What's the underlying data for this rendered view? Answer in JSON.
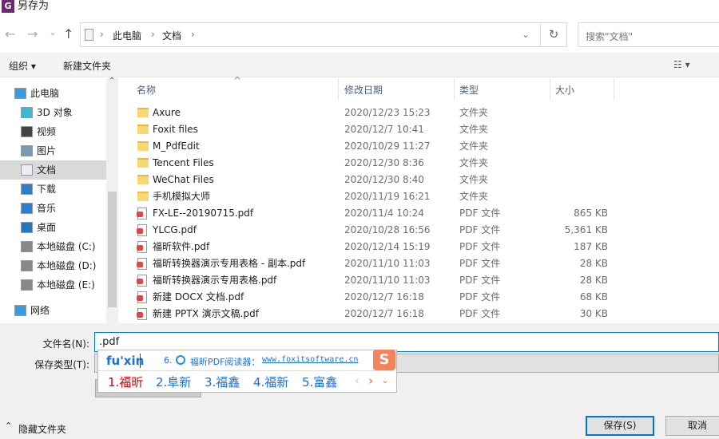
{
  "window": {
    "title": "另存为"
  },
  "nav": {
    "back": "←",
    "forward": "→",
    "recent": "⌄",
    "up": "↑",
    "breadcrumb": [
      "此电脑",
      "文档"
    ],
    "refresh": "↻",
    "search_placeholder": "搜索\"文档\""
  },
  "toolbar": {
    "organize": "组织 ▾",
    "new_folder": "新建文件夹",
    "view": "☷ ▾"
  },
  "sidebar": {
    "items": [
      {
        "label": "此电脑",
        "icon": "computer-icon",
        "indent": 0
      },
      {
        "label": "3D 对象",
        "icon": "cube-icon",
        "indent": 1
      },
      {
        "label": "视频",
        "icon": "video-icon",
        "indent": 1
      },
      {
        "label": "图片",
        "icon": "picture-icon",
        "indent": 1
      },
      {
        "label": "文档",
        "icon": "document-icon",
        "indent": 1,
        "selected": true
      },
      {
        "label": "下载",
        "icon": "download-icon",
        "indent": 1
      },
      {
        "label": "音乐",
        "icon": "music-icon",
        "indent": 1
      },
      {
        "label": "桌面",
        "icon": "desktop-icon",
        "indent": 1
      },
      {
        "label": "本地磁盘 (C:)",
        "icon": "drive-icon",
        "indent": 1
      },
      {
        "label": "本地磁盘 (D:)",
        "icon": "drive-icon",
        "indent": 1
      },
      {
        "label": "本地磁盘 (E:)",
        "icon": "drive-icon",
        "indent": 1
      },
      {
        "label": "网络",
        "icon": "network-icon",
        "indent": 0
      }
    ]
  },
  "columns": {
    "name": "名称",
    "date": "修改日期",
    "type": "类型",
    "size": "大小"
  },
  "files": [
    {
      "name": "Axure",
      "date": "2020/12/23 15:23",
      "type": "文件夹",
      "size": "",
      "kind": "folder"
    },
    {
      "name": "Foxit files",
      "date": "2020/12/7 10:41",
      "type": "文件夹",
      "size": "",
      "kind": "folder"
    },
    {
      "name": "M_PdfEdit",
      "date": "2020/10/29 11:27",
      "type": "文件夹",
      "size": "",
      "kind": "folder"
    },
    {
      "name": "Tencent Files",
      "date": "2020/12/30 8:36",
      "type": "文件夹",
      "size": "",
      "kind": "folder"
    },
    {
      "name": "WeChat Files",
      "date": "2020/12/30 8:40",
      "type": "文件夹",
      "size": "",
      "kind": "folder"
    },
    {
      "name": "手机模拟大师",
      "date": "2020/11/19 16:21",
      "type": "文件夹",
      "size": "",
      "kind": "folder"
    },
    {
      "name": "FX-LE--20190715.pdf",
      "date": "2020/11/4 10:24",
      "type": "PDF 文件",
      "size": "865 KB",
      "kind": "pdf"
    },
    {
      "name": "YLCG.pdf",
      "date": "2020/10/28 16:56",
      "type": "PDF 文件",
      "size": "5,361 KB",
      "kind": "pdf"
    },
    {
      "name": "福昕软件.pdf",
      "date": "2020/12/14 15:19",
      "type": "PDF 文件",
      "size": "187 KB",
      "kind": "pdf"
    },
    {
      "name": "福昕转换器演示专用表格 - 副本.pdf",
      "date": "2020/11/10 11:03",
      "type": "PDF 文件",
      "size": "28 KB",
      "kind": "pdf"
    },
    {
      "name": "福昕转换器演示专用表格.pdf",
      "date": "2020/11/10 11:03",
      "type": "PDF 文件",
      "size": "28 KB",
      "kind": "pdf"
    },
    {
      "name": "新建 DOCX 文档.pdf",
      "date": "2020/12/7 16:18",
      "type": "PDF 文件",
      "size": "68 KB",
      "kind": "pdf"
    },
    {
      "name": "新建 PPTX 演示文稿.pdf",
      "date": "2020/12/7 16:18",
      "type": "PDF 文件",
      "size": "30 KB",
      "kind": "pdf"
    }
  ],
  "form": {
    "filename_label": "文件名(N):",
    "filename_value": ".pdf",
    "savetype_label": "保存类型(T):",
    "hide_folders": "隐藏文件夹",
    "save": "保存(S)",
    "cancel": "取消"
  },
  "ime": {
    "composition": "fu'xin",
    "hint_prefix": "6.",
    "hint_text": "福昕PDF阅读器：",
    "hint_url": "www.foxitsoftware.cn",
    "candidates": [
      "1.福昕",
      "2.阜新",
      "3.福鑫",
      "4.福新",
      "5.富鑫"
    ],
    "prev": "‹",
    "next": "›",
    "expand": "⌄",
    "logo": "S"
  },
  "colors": {
    "accent": "#0078d7",
    "ime_selected": "#e00000",
    "ime_text": "#1a6fd8"
  }
}
